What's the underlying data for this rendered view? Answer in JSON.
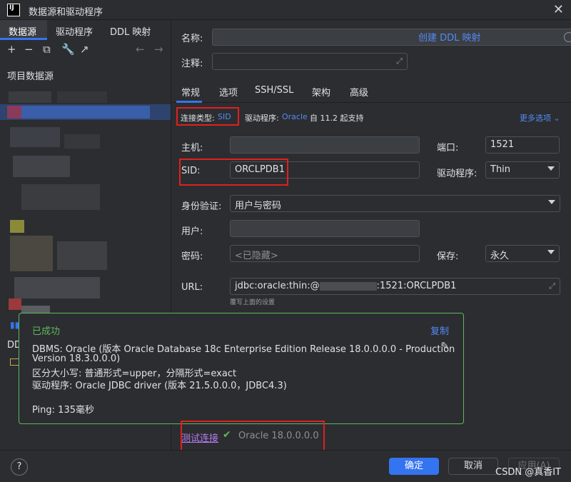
{
  "window": {
    "title": "数据源和驱动程序",
    "logo_text": "IJ"
  },
  "left_panel": {
    "tabs": [
      "数据源",
      "驱动程序",
      "DDL 映射"
    ],
    "section_title": "项目数据源",
    "footer_label": "DD"
  },
  "form": {
    "name_label": "名称:",
    "create_ddl_link": "创建 DDL 映射",
    "comment_label": "注释:",
    "tabs": [
      "常规",
      "选项",
      "SSH/SSL",
      "架构",
      "高级"
    ],
    "conn_type_label": "连接类型:",
    "conn_type_value": "SID",
    "driver_label": "驱动程序:",
    "driver_value": "Oracle",
    "driver_support": "自 11.2 起支持",
    "more_options": "更多选项",
    "host_label": "主机:",
    "port_label": "端口:",
    "port_value": "1521",
    "sid_label": "SID:",
    "sid_value": "ORCLPDB1",
    "driver2_label": "驱动程序:",
    "driver2_value": "Thin",
    "auth_label": "身份验证:",
    "auth_value": "用户与密码",
    "user_label": "用户:",
    "password_label": "密码:",
    "password_placeholder": "<已隐藏>",
    "save_label": "保存:",
    "save_value": "永久",
    "url_label": "URL:",
    "url_prefix": "jdbc:oracle:thin:@",
    "url_suffix": ":1521:ORCLPDB1",
    "url_hint": "覆写上面的设置"
  },
  "popup": {
    "status": "已成功",
    "copy": "复制",
    "line1": "DBMS: Oracle (版本 Oracle Database 18c Enterprise Edition Release 18.0.0.0.0 - Production",
    "line2": "Version 18.3.0.0.0)",
    "line3": "区分大小写: 普通形式=upper，分隔形式=exact",
    "line4": "驱动程序: Oracle JDBC driver (版本 21.5.0.0.0，JDBC4.3)",
    "line5": "Ping: 135毫秒"
  },
  "test": {
    "link": "测试连接",
    "result": "Oracle 18.0.0.0.0"
  },
  "buttons": {
    "ok": "确定",
    "cancel": "取消",
    "apply": "应用(A)",
    "help": "?"
  },
  "watermark": "CSDN @真香IT",
  "colors": {
    "accent": "#3574f0",
    "success": "#5fb85f",
    "link": "#548af7",
    "highlight": "#e02020"
  }
}
